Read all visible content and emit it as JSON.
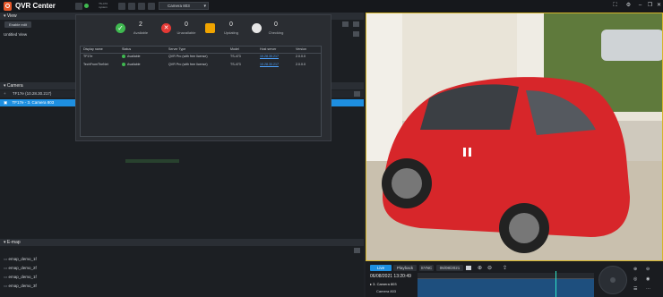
{
  "app": {
    "title": "QVR Center"
  },
  "toolbar": {
    "server_ip": "TS-473",
    "sub": "system",
    "camera_select": "Camera 803"
  },
  "view_panel": {
    "title": "View",
    "enable_edit": "Enable edit",
    "item": "Untitled View"
  },
  "camera_panel": {
    "title": "Camera",
    "server_row": "TF17e (10.28.30.217)",
    "camera_row": "TF17e - 3. Camera 803"
  },
  "emap_panel": {
    "title": "E-map",
    "items": [
      "emap_demo_1f",
      "emap_demo_2f",
      "emap_demo_1f",
      "emap_demo_3f"
    ]
  },
  "status": {
    "available": {
      "count": "2",
      "label": "Available"
    },
    "unavailable": {
      "count": "0",
      "label": "Unavailable"
    },
    "updating": {
      "count": "0",
      "label": "Updating"
    },
    "checking": {
      "count": "0",
      "label": "Checking"
    }
  },
  "table": {
    "headers": [
      "Display name",
      "Status",
      "Server Type",
      "Model",
      "Host server",
      "Version"
    ],
    "rows": [
      {
        "name": "TF17e",
        "status": "Available",
        "type": "QVR Pro (with free license)",
        "model": "TS-473",
        "host": "10.28.30.217",
        "version": "2.0.0.0"
      },
      {
        "name": "TechFromTheNet",
        "status": "Available",
        "type": "QVR Pro (with free license)",
        "model": "TS-473",
        "host": "10.28.30.217",
        "version": "2.0.0.0"
      }
    ]
  },
  "playback": {
    "live": "Live",
    "playback": "Playback",
    "sync": "SYNC",
    "date": "06/08/2021",
    "timestamp": "06/08/2021 13:20:49",
    "camera_label": "3. Camera 803",
    "camera_row": "Camera 803"
  },
  "colors": {
    "accent": "#1e8fe0",
    "brand": "#e8592a",
    "ok": "#3fb950",
    "error": "#e53935",
    "warn": "#f0a400"
  }
}
